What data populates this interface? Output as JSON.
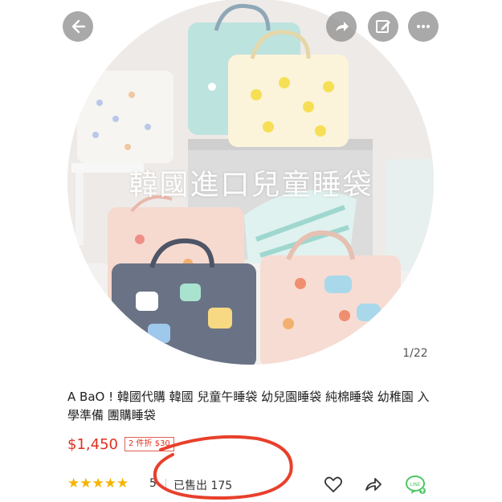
{
  "image": {
    "overlay_text": "韓國進口兒童睡袋",
    "counter": "1/22"
  },
  "top_buttons": {
    "back": "back-arrow-icon",
    "share": "share-icon",
    "edit": "edit-icon",
    "more": "more-icon"
  },
  "product": {
    "title": "A BaO ! 韓國代購 韓國  兒童午睡袋 幼兒園睡袋 純棉睡袋 幼稚園 入學準備 團購睡袋",
    "price": "$1,450",
    "promo": "2 件折 $30",
    "stars": "★★★★★",
    "rating": "5",
    "sold": "已售出 175"
  },
  "actions": {
    "like": "heart-icon",
    "share": "share-arrow-icon",
    "line": "LINE"
  },
  "colors": {
    "price": "#e0301e",
    "star": "#f5b400",
    "line": "#4cc764",
    "annotation": "#e8402c"
  }
}
